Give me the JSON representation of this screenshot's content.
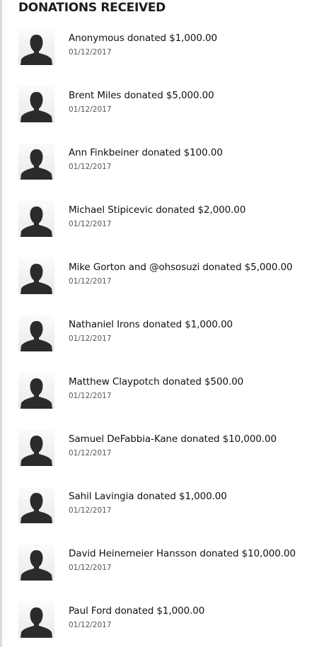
{
  "heading": "DONATIONS RECEIVED",
  "donations": [
    {
      "text": "Anonymous donated $1,000.00",
      "date": "01/12/2017",
      "avatar_icon": "default-user-silhouette"
    },
    {
      "text": "Brent Miles donated $5,000.00",
      "date": "01/12/2017",
      "avatar_icon": "default-user-silhouette"
    },
    {
      "text": "Ann Finkbeiner donated $100.00",
      "date": "01/12/2017",
      "avatar_icon": "default-user-silhouette"
    },
    {
      "text": "Michael Stipicevic donated $2,000.00",
      "date": "01/12/2017",
      "avatar_icon": "default-user-silhouette"
    },
    {
      "text": "Mike Gorton and @ohsosuzi donated $5,000.00",
      "date": "01/12/2017",
      "avatar_icon": "default-user-silhouette"
    },
    {
      "text": "Nathaniel Irons donated $1,000.00",
      "date": "01/12/2017",
      "avatar_icon": "default-user-silhouette"
    },
    {
      "text": "Matthew Claypotch donated $500.00",
      "date": "01/12/2017",
      "avatar_icon": "default-user-silhouette"
    },
    {
      "text": "Samuel DeFabbia-Kane donated $10,000.00",
      "date": "01/12/2017",
      "avatar_icon": "default-user-silhouette"
    },
    {
      "text": "Sahil Lavingia donated $1,000.00",
      "date": "01/12/2017",
      "avatar_icon": "default-user-silhouette"
    },
    {
      "text": "David Heinemeier Hansson donated $10,000.00",
      "date": "01/12/2017",
      "avatar_icon": "default-user-silhouette"
    },
    {
      "text": "Paul Ford donated $1,000.00",
      "date": "01/12/2017",
      "avatar_icon": "default-user-silhouette"
    }
  ],
  "colors": {
    "heading": "#1c1c1c",
    "donor_text": "#111111",
    "date_text": "#555555",
    "silhouette": "#2b2b2b",
    "avatar_bg": "#f0f0f0",
    "left_border": "#dcdcdc"
  }
}
